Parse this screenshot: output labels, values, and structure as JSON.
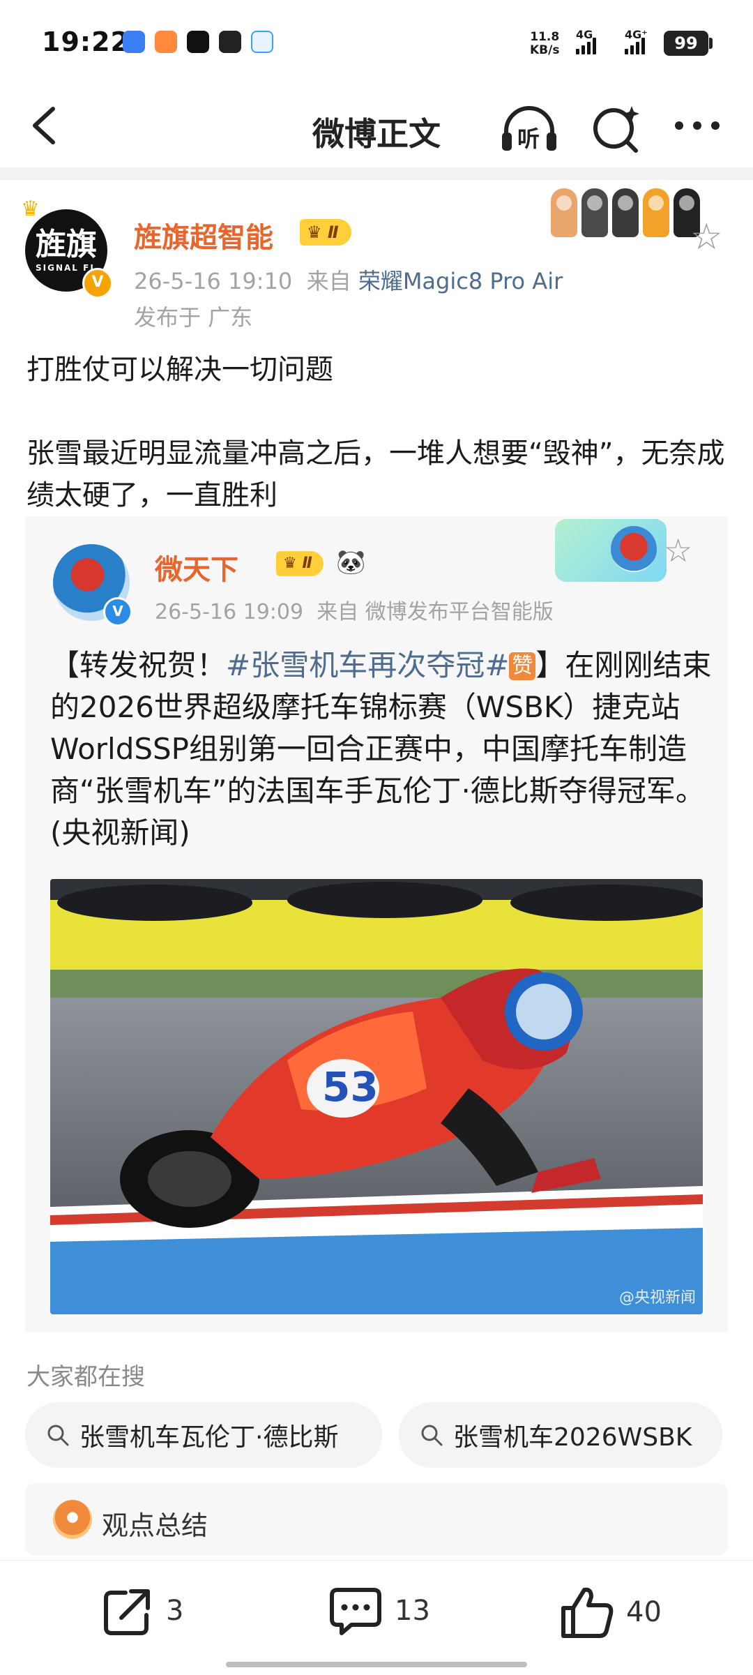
{
  "status_bar": {
    "time": "19:22",
    "net_speed": "11.8",
    "net_speed_unit": "KB/s",
    "net_type_1": "4G",
    "net_type_2": "4G⁺",
    "battery": "99"
  },
  "nav": {
    "title": "微博正文",
    "back_icon": "chevron-left-icon",
    "listen_label": "听",
    "search_icon": "ai-search-icon",
    "more_icon": "more-dots-icon"
  },
  "post": {
    "author": {
      "avatar_text": "旌旗",
      "avatar_subtext": "SIGNAL FL",
      "name": "旌旗超智能",
      "vip_level": "Ⅱ",
      "verified_mark": "V"
    },
    "time": "26-5-16 19:10",
    "source_prefix": "来自",
    "source_device": "荣耀Magic8 Pro Air",
    "location": "发布于 广东",
    "text_line_1": "打胜仗可以解决一切问题",
    "text_line_2": "张雪最近明显流量冲高之后，一堆人想要“毁神”，无奈成绩太硬了，一直胜利",
    "paw_colors": [
      "#e9a56b",
      "#4a4a4a",
      "#3a3a3a",
      "#f2a22a",
      "#222222"
    ]
  },
  "repost": {
    "author": {
      "name": "微天下",
      "vip_level": "Ⅱ",
      "verified_mark": "V"
    },
    "time": "26-5-16 19:09",
    "source": "来自 微博发布平台智能版",
    "text_prefix": "【转发祝贺！",
    "hashtag": "#张雪机车再次夺冠#",
    "zan": "赞",
    "text_body": "】在刚刚结束的2026世界超级摩托车锦标赛（WSBK）捷克站WorldSSP组别第一回合正赛中，中国摩托车制造商“张雪机车”的法国车手瓦伦丁·德比斯夺得冠军。(央视新闻)",
    "image": {
      "race_number": "53",
      "watermark": "@央视新闻"
    }
  },
  "hot_search": {
    "title": "大家都在搜",
    "chips": [
      {
        "label": "张雪机车瓦伦丁·德比斯"
      },
      {
        "label": "张雪机车2026WSBK"
      }
    ]
  },
  "summary": {
    "label": "观点总结"
  },
  "actions": {
    "repost_count": "3",
    "comment_count": "13",
    "like_count": "40"
  }
}
